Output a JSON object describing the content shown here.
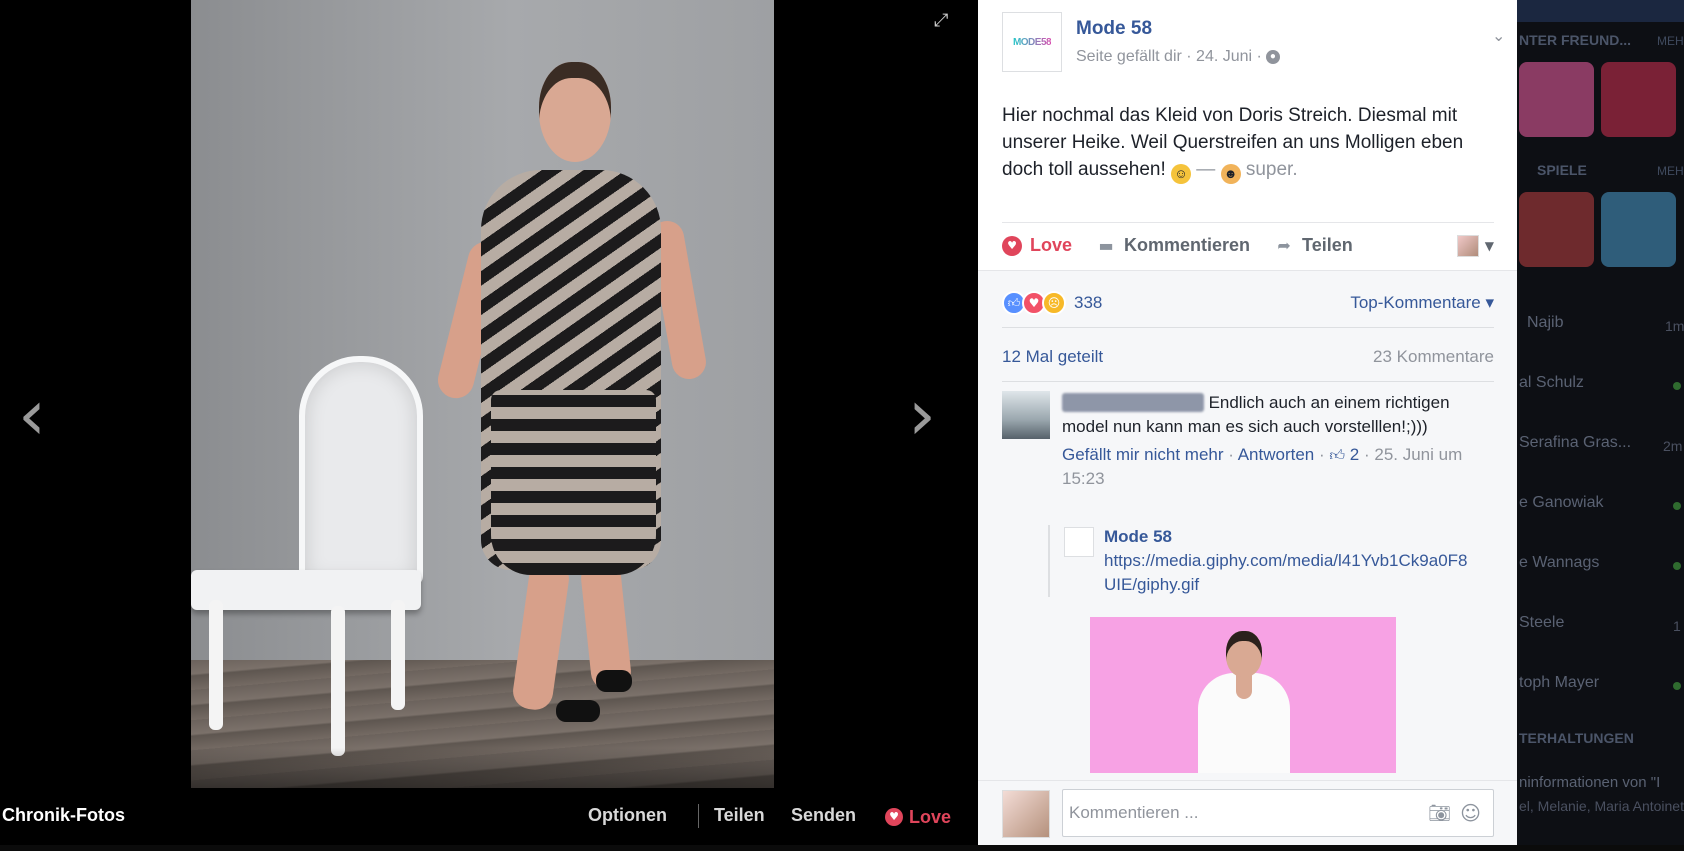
{
  "viewer": {
    "bottom_left_label": "Chronik-Fotos",
    "options_label": "Optionen",
    "share_label": "Teilen",
    "send_label": "Senden",
    "love_label": "Love"
  },
  "post": {
    "page_name": "Mode 58",
    "page_logo_text": "MODE58",
    "meta": "Seite gefällt dir · 24. Juni ·",
    "text_main": "Hier nochmal das Kleid von Doris Streich. Diesmal mit unserer Heike. Weil Querstreifen an uns Molligen eben doch toll aussehen!",
    "dash": "—",
    "feeling": "super."
  },
  "actions": {
    "love": "Love",
    "comment": "Kommentieren",
    "share": "Teilen"
  },
  "stats": {
    "reaction_count": "338",
    "sort_label": "Top-Kommentare",
    "shares": "12 Mal geteilt",
    "comments": "23 Kommentare"
  },
  "comment": {
    "author": "xxxxxxxxxxxxxxx",
    "text": "Endlich auch an einem richtigen model nun kann man es sich auch vorstelllen!;)))",
    "unlike": "Gefällt mir nicht mehr",
    "reply": "Antworten",
    "like_count": "2",
    "time": "25. Juni um 15:23"
  },
  "reply": {
    "author": "Mode 58",
    "url": "https://media.giphy.com/media/l41Yvb1Ck9a0F8UIE/giphy.gif"
  },
  "composer": {
    "placeholder": "Kommentieren ..."
  },
  "background_sidebar": {
    "heading_friends": "NTER FREUND...",
    "heading_games": "SPIELE",
    "heading_chats": "TERHALTUNGEN",
    "more": "MEH",
    "contacts": [
      {
        "name": "Najib",
        "extra": "1m"
      },
      {
        "name": "al Schulz",
        "extra": ""
      },
      {
        "name": "Serafina Gras...",
        "extra": "2m"
      },
      {
        "name": "e Ganowiak",
        "extra": ""
      },
      {
        "name": "e Wannags",
        "extra": ""
      },
      {
        "name": "Steele",
        "extra": "1"
      },
      {
        "name": "toph Mayer",
        "extra": ""
      }
    ],
    "conv_title": "ninformationen von \"I",
    "conv_sub": "el, Melanie, Maria Antoinet"
  }
}
